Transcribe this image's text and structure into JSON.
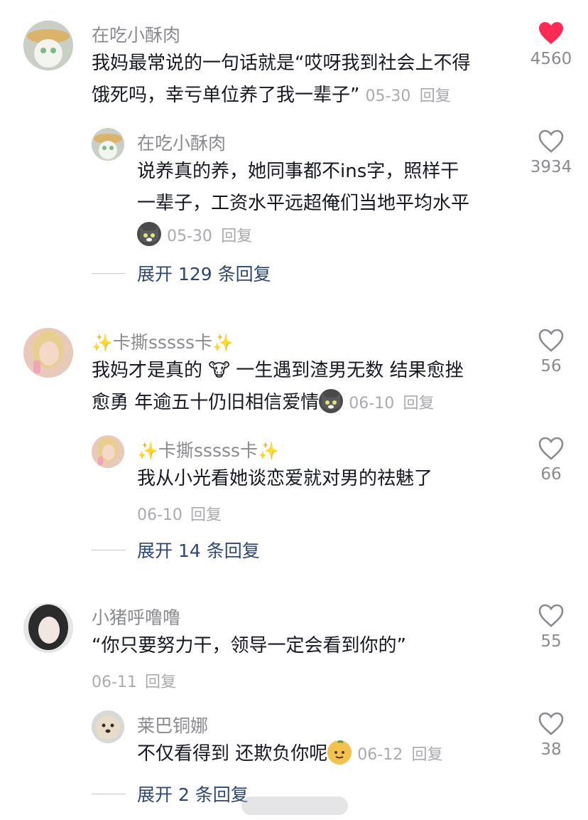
{
  "comments": [
    {
      "user": "在吃小酥肉",
      "text_line1": "我妈最常说的一句话就是“哎呀我到社会上不得",
      "text_line2": "饿死吗，幸亏单位养了我一辈子”",
      "date": "05-30",
      "reply_label": "回复",
      "likes": "4560",
      "liked": true,
      "reply": {
        "user": "在吃小酥肉",
        "text_line1": "说养真的养，她同事都不ins字，照样干",
        "text_line2": "一辈子，工资水平远超俺们当地平均水平",
        "date": "05-30",
        "reply_label": "回复",
        "likes": "3934",
        "emoji": "cat-face"
      },
      "expand_label": "展开 129 条回复"
    },
    {
      "user": "卡撕sssss卡",
      "text_line1": "我妈才是真的 🐮 一生遇到渣男无数 结果愈挫",
      "text_line2": "愈勇 年逾五十仍旧相信爱情",
      "date": "06-10",
      "reply_label": "回复",
      "likes": "56",
      "reply": {
        "user": "卡撕sssss卡",
        "text_line1": "我从小光看她谈恋爱就对男的祛魅了",
        "date": "06-10",
        "reply_label": "回复",
        "likes": "66"
      },
      "expand_label": "展开 14 条回复"
    },
    {
      "user": "小猪呼噜噜",
      "text_line1": "“你只要努力干，领导一定会看到你的”",
      "date": "06-11",
      "reply_label": "回复",
      "likes": "55",
      "reply": {
        "user": "莱巴铜娜",
        "text_line1": "不仅看得到 还欺负你呢",
        "date": "06-12",
        "reply_label": "回复",
        "likes": "38"
      },
      "expand_label": "展开 2 条回复"
    }
  ],
  "colors": {
    "liked_heart": "#fe2c55",
    "username": "#8a8b91",
    "expand_link": "#2e4772"
  }
}
